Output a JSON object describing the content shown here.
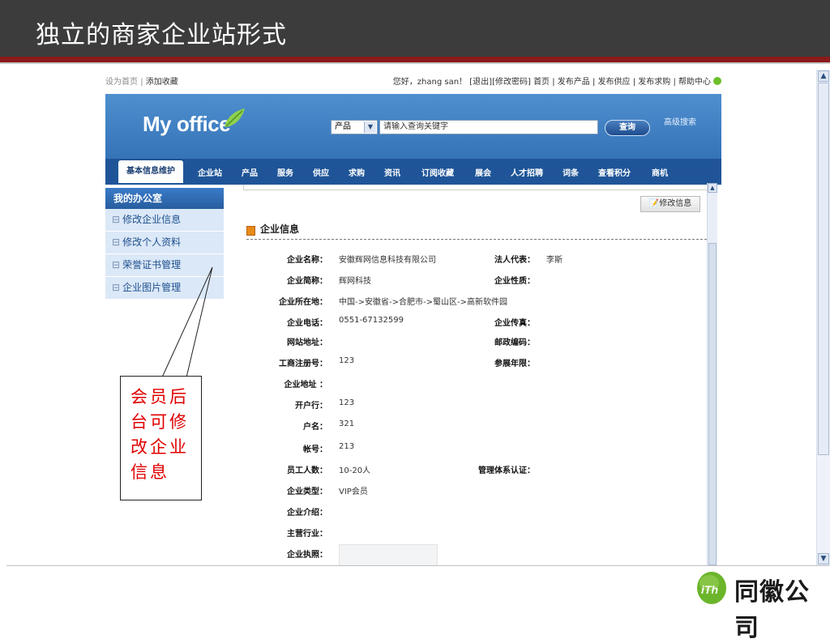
{
  "slide": {
    "title": "独立的商家企业站形式",
    "callout_text": "会员后台可修改企业信息",
    "company_name": "同徽公司",
    "company_logo_text": "iTh"
  },
  "topbar": {
    "set_home": "设为首页",
    "separator": "|",
    "add_favorite": "添加收藏",
    "greeting": "您好，zhang san！",
    "links": [
      "[退出]",
      "[修改密码]",
      "首页",
      "发布产品",
      "发布供应",
      "发布求购",
      "帮助中心"
    ]
  },
  "banner": {
    "logo": "My office",
    "search_select": "产品",
    "search_placeholder": "请输入查询关键字",
    "search_button": "查询",
    "advanced_search": "高级搜索"
  },
  "nav": {
    "items": [
      "基本信息维护",
      "企业站",
      "产品",
      "服务",
      "供应",
      "求购",
      "资讯",
      "订阅收藏",
      "展会",
      "人才招聘",
      "词条",
      "查看积分",
      "商机"
    ]
  },
  "sidebar": {
    "heading": "我的办公室",
    "items": [
      "修改企业信息",
      "修改个人资料",
      "荣誉证书管理",
      "企业图片管理"
    ]
  },
  "content": {
    "modify_button": "修改信息",
    "section_title": "企业信息",
    "fields_left": [
      {
        "label": "企业名称：",
        "value": "安徽辉网信息科技有限公司"
      },
      {
        "label": "企业简称：",
        "value": "辉网科技"
      },
      {
        "label": "企业所在地：",
        "value": "中国->安徽省->合肥市->蜀山区->高新软件园"
      },
      {
        "label": "企业电话：",
        "value": "0551-67132599"
      },
      {
        "label": "网站地址：",
        "value": ""
      },
      {
        "label": "工商注册号：",
        "value": "123"
      },
      {
        "label": "企业地址 ：",
        "value": ""
      },
      {
        "label": "开户行：",
        "value": "123"
      },
      {
        "label": "户名：",
        "value": "321"
      },
      {
        "label": "帐号：",
        "value": "213"
      },
      {
        "label": "员工人数：",
        "value": "10-20人"
      },
      {
        "label": "企业类型：",
        "value": "VIP会员"
      },
      {
        "label": "企业介绍：",
        "value": ""
      },
      {
        "label": "主营行业：",
        "value": ""
      },
      {
        "label": "企业执照：",
        "value": ""
      }
    ],
    "fields_right": [
      {
        "label": "法人代表：",
        "value": "李斯"
      },
      {
        "label": "企业性质：",
        "value": ""
      },
      {
        "label": "企业传真：",
        "value": ""
      },
      {
        "label": "邮政编码：",
        "value": ""
      },
      {
        "label": "参展年限：",
        "value": ""
      },
      {
        "label": "管理体系认证：",
        "value": ""
      }
    ]
  },
  "colors": {
    "slide_header_bg": "#3c3c3c",
    "slide_header_rule": "#8b1a1a",
    "banner_blue": "#2a68ad",
    "nav_blue": "#1f5598",
    "callout_text": "#e00000"
  },
  "icons": [
    "dropdown-arrow-icon",
    "help-icon",
    "leaf-icon",
    "edit-icon",
    "section-bullet-icon",
    "scroll-up-icon",
    "scroll-down-icon"
  ]
}
